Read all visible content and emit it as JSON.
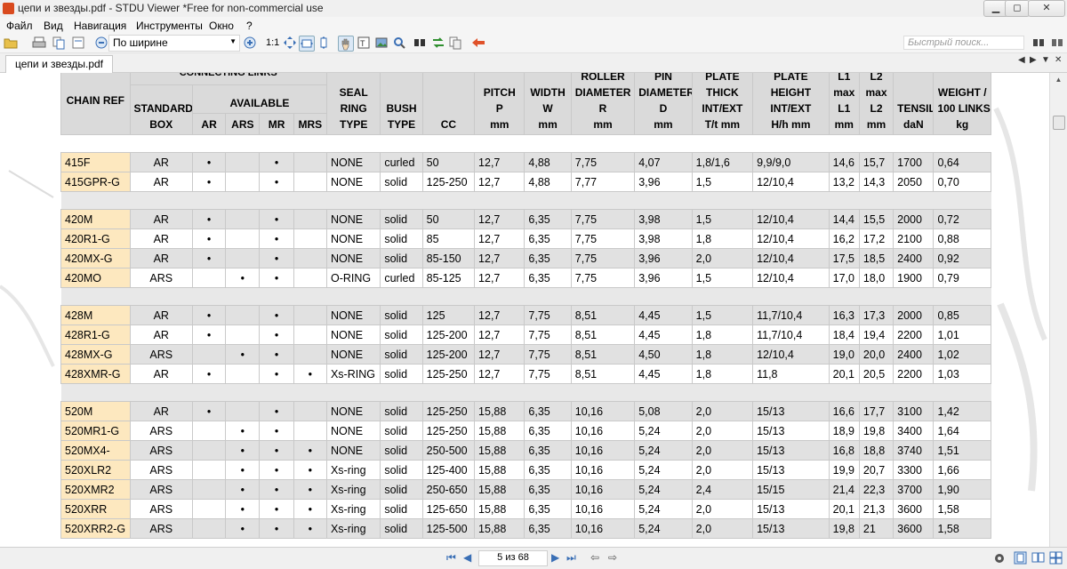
{
  "window": {
    "title": "цепи и звезды.pdf - STDU Viewer *Free for non-commercial use",
    "minimize_label": "▁",
    "maximize_label": "◻",
    "close_label": "✕"
  },
  "menu": [
    "Файл",
    "Вид",
    "Навигация",
    "Инструменты",
    "Окно",
    "?"
  ],
  "toolbar": {
    "zoom_value": "По ширине",
    "ratio_label": "1:1",
    "search_placeholder": "Быстрый поиск..."
  },
  "tab": {
    "label": "цепи и звезды.pdf"
  },
  "table": {
    "header": {
      "chain_ref": "CHAIN REF",
      "connecting_links": "CONNECTING LINKS",
      "standard_box": [
        "STANDARD",
        "BOX"
      ],
      "available": "AVAILABLE",
      "available_cols": [
        "AR",
        "ARS",
        "MR",
        "MRS"
      ],
      "seal_ring_type": [
        "SEAL",
        "RING",
        "TYPE"
      ],
      "bush_type": [
        "BUSH",
        "TYPE"
      ],
      "cc": "CC",
      "pitch": [
        "PITCH",
        "P",
        "mm"
      ],
      "width": [
        "WIDTH",
        "W",
        "mm"
      ],
      "roller_diameter": [
        "ROLLER",
        "DIAMETER",
        "R",
        "mm"
      ],
      "pin_diameter": [
        "PIN",
        "DIAMETER",
        "D",
        "mm"
      ],
      "plate_thick": [
        "PLATE",
        "THICK",
        "INT/EXT",
        "T/t mm"
      ],
      "plate_height": [
        "PLATE",
        "HEIGHT",
        "INT/EXT",
        "H/h mm"
      ],
      "l1": [
        "L1",
        "max",
        "L1",
        "mm"
      ],
      "l2": [
        "L2",
        "max",
        "L2",
        "mm"
      ],
      "tensile": [
        "TENSILE",
        "daN"
      ],
      "weight": [
        "WEIGHT /",
        "100 LINKS",
        "kg"
      ]
    },
    "groups": [
      {
        "rows": [
          [
            "415F",
            "AR",
            "•",
            "",
            "•",
            "",
            "NONE",
            "curled",
            "50",
            "12,7",
            "4,88",
            "7,75",
            "4,07",
            "1,8/1,6",
            "9,9/9,0",
            "14,6",
            "15,7",
            "1700",
            "0,64"
          ],
          [
            "415GPR-G",
            "AR",
            "•",
            "",
            "•",
            "",
            "NONE",
            "solid",
            "125-250",
            "12,7",
            "4,88",
            "7,77",
            "3,96",
            "1,5",
            "12/10,4",
            "13,2",
            "14,3",
            "2050",
            "0,70"
          ]
        ]
      },
      {
        "rows": [
          [
            "420M",
            "AR",
            "•",
            "",
            "•",
            "",
            "NONE",
            "solid",
            "50",
            "12,7",
            "6,35",
            "7,75",
            "3,98",
            "1,5",
            "12/10,4",
            "14,4",
            "15,5",
            "2000",
            "0,72"
          ],
          [
            "420R1-G",
            "AR",
            "•",
            "",
            "•",
            "",
            "NONE",
            "solid",
            "85",
            "12,7",
            "6,35",
            "7,75",
            "3,98",
            "1,8",
            "12/10,4",
            "16,2",
            "17,2",
            "2100",
            "0,88"
          ],
          [
            "420MX-G",
            "AR",
            "•",
            "",
            "•",
            "",
            "NONE",
            "solid",
            "85-150",
            "12,7",
            "6,35",
            "7,75",
            "3,96",
            "2,0",
            "12/10,4",
            "17,5",
            "18,5",
            "2400",
            "0,92"
          ],
          [
            "420MO",
            "ARS",
            "",
            "•",
            "•",
            "",
            "O-RING",
            "curled",
            "85-125",
            "12,7",
            "6,35",
            "7,75",
            "3,96",
            "1,5",
            "12/10,4",
            "17,0",
            "18,0",
            "1900",
            "0,79"
          ]
        ]
      },
      {
        "rows": [
          [
            "428M",
            "AR",
            "•",
            "",
            "•",
            "",
            "NONE",
            "solid",
            "125",
            "12,7",
            "7,75",
            "8,51",
            "4,45",
            "1,5",
            "11,7/10,4",
            "16,3",
            "17,3",
            "2000",
            "0,85"
          ],
          [
            "428R1-G",
            "AR",
            "•",
            "",
            "•",
            "",
            "NONE",
            "solid",
            "125-200",
            "12,7",
            "7,75",
            "8,51",
            "4,45",
            "1,8",
            "11,7/10,4",
            "18,4",
            "19,4",
            "2200",
            "1,01"
          ],
          [
            "428MX-G",
            "ARS",
            "",
            "•",
            "•",
            "",
            "NONE",
            "solid",
            "125-200",
            "12,7",
            "7,75",
            "8,51",
            "4,50",
            "1,8",
            "12/10,4",
            "19,0",
            "20,0",
            "2400",
            "1,02"
          ],
          [
            "428XMR-G",
            "AR",
            "•",
            "",
            "•",
            "•",
            "Xs-RING",
            "solid",
            "125-250",
            "12,7",
            "7,75",
            "8,51",
            "4,45",
            "1,8",
            "11,8",
            "20,1",
            "20,5",
            "2200",
            "1,03"
          ]
        ]
      },
      {
        "rows": [
          [
            "520M",
            "AR",
            "•",
            "",
            "•",
            "",
            "NONE",
            "solid",
            "125-250",
            "15,88",
            "6,35",
            "10,16",
            "5,08",
            "2,0",
            "15/13",
            "16,6",
            "17,7",
            "3100",
            "1,42"
          ],
          [
            "520MR1-G",
            "ARS",
            "",
            "•",
            "•",
            "",
            "NONE",
            "solid",
            "125-250",
            "15,88",
            "6,35",
            "10,16",
            "5,24",
            "2,0",
            "15/13",
            "18,9",
            "19,8",
            "3400",
            "1,64"
          ],
          [
            "520MX4-",
            "ARS",
            "",
            "•",
            "•",
            "•",
            "NONE",
            "solid",
            "250-500",
            "15,88",
            "6,35",
            "10,16",
            "5,24",
            "2,0",
            "15/13",
            "16,8",
            "18,8",
            "3740",
            "1,51"
          ],
          [
            "520XLR2",
            "ARS",
            "",
            "•",
            "•",
            "•",
            "Xs-ring",
            "solid",
            "125-400",
            "15,88",
            "6,35",
            "10,16",
            "5,24",
            "2,0",
            "15/13",
            "19,9",
            "20,7",
            "3300",
            "1,66"
          ],
          [
            "520XMR2",
            "ARS",
            "",
            "•",
            "•",
            "•",
            "Xs-ring",
            "solid",
            "250-650",
            "15,88",
            "6,35",
            "10,16",
            "5,24",
            "2,4",
            "15/15",
            "21,4",
            "22,3",
            "3700",
            "1,90"
          ],
          [
            "520XRR",
            "ARS",
            "",
            "•",
            "•",
            "•",
            "Xs-ring",
            "solid",
            "125-650",
            "15,88",
            "6,35",
            "10,16",
            "5,24",
            "2,0",
            "15/13",
            "20,1",
            "21,3",
            "3600",
            "1,58"
          ],
          [
            "520XRR2-G",
            "ARS",
            "",
            "•",
            "•",
            "•",
            "Xs-ring",
            "solid",
            "125-500",
            "15,88",
            "6,35",
            "10,16",
            "5,24",
            "2,0",
            "15/13",
            "19,8",
            "21",
            "3600",
            "1,58"
          ]
        ]
      }
    ]
  },
  "statusbar": {
    "page_indicator": "5 из 68",
    "first_label": "⏮",
    "prev_label": "◀",
    "next_label": "▶",
    "last_label": "⏭",
    "back_label": "⇦",
    "forward_label": "⇨"
  }
}
